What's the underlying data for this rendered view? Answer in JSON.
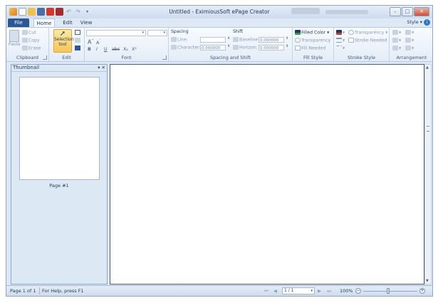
{
  "window": {
    "title": "Untitled - EximiousSoft ePage Creator"
  },
  "tabs": {
    "file": "File",
    "home": "Home",
    "edit": "Edit",
    "view": "View"
  },
  "style_menu": "Style",
  "clipboard": {
    "paste": "Paste",
    "cut": "Cut",
    "copy": "Copy",
    "erase": "Erase",
    "label": "Clipboard"
  },
  "edit_group": {
    "selection_tool": "Selection tool",
    "label": "Edit"
  },
  "font_group": {
    "bold": "B",
    "italic": "I",
    "underline": "U",
    "strike": "abc",
    "subscript": "X₂",
    "superscript": "X²",
    "grow": "A",
    "shrink": "A",
    "label": "Font"
  },
  "spacing": {
    "title": "Spacing",
    "line": "Line:",
    "character": "Character:",
    "character_value": "0.000000"
  },
  "shift": {
    "title": "Shift",
    "baseline": "Baseline:",
    "baseline_value": "0.000000",
    "horizon": "Horizon:",
    "horizon_value": "0.000000"
  },
  "spacing_shift_label": "Spacing and Shift",
  "fill_style": {
    "filled_color": "Filled Color",
    "transparency": "Transparency",
    "fill_needed": "Fill Needed",
    "label": "Fill Style"
  },
  "stroke_style": {
    "transparency": "Transparency",
    "stroke_needed": "Stroke Needed",
    "label": "Stroke Style"
  },
  "arrangement": {
    "label": "Arrangement"
  },
  "thumbnail_panel": {
    "title": "Thumbnail",
    "page_label": "Page #1"
  },
  "status": {
    "page": "Page 1 of 1",
    "help": "For Help, press F1",
    "page_selector": "1 / 1",
    "zoom": "100%"
  },
  "colors": {
    "accent": "#2b5797",
    "selection_tool": "#f7c65a",
    "ribbon": "#e3ecf7"
  }
}
